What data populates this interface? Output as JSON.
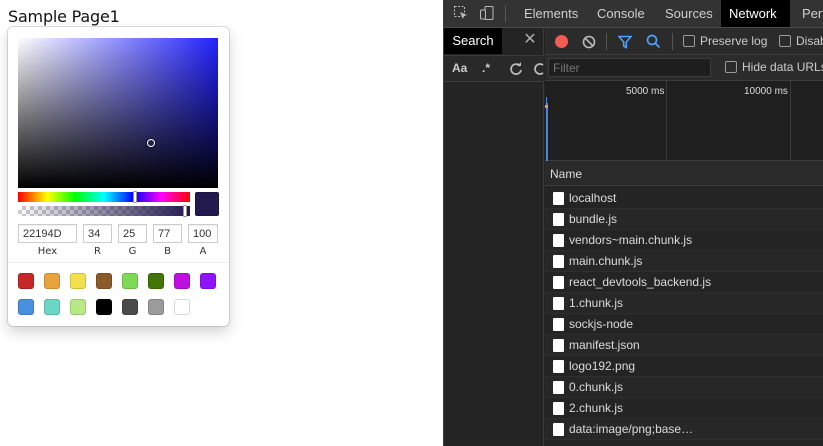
{
  "page": {
    "title": "Sample Page1"
  },
  "color_picker": {
    "current_color": "#22194d",
    "fields": [
      {
        "label": "Hex",
        "value": "22194D"
      },
      {
        "label": "R",
        "value": "34"
      },
      {
        "label": "G",
        "value": "25"
      },
      {
        "label": "B",
        "value": "77"
      },
      {
        "label": "A",
        "value": "100"
      }
    ],
    "presets": [
      "#c62828",
      "#e8a33d",
      "#f4e04d",
      "#8b5a2b",
      "#7ed957",
      "#417505",
      "#bd10e0",
      "#9013fe",
      "#4a90e2",
      "#6dd5c4",
      "#b8e986",
      "#000000",
      "#4a4a4a",
      "#9b9b9b",
      "#ffffff"
    ]
  },
  "devtools": {
    "tabs": [
      {
        "label": "Elements",
        "active": false
      },
      {
        "label": "Console",
        "active": false
      },
      {
        "label": "Sources",
        "active": false
      },
      {
        "label": "Network",
        "active": true
      },
      {
        "label": "Perf",
        "active": false
      }
    ],
    "search": {
      "tab_label": "Search",
      "close": "✕",
      "case_option": "Aa",
      "regex_option": ".*"
    },
    "network": {
      "preserve_log_label": "Preserve log",
      "disable_cache_label": "Disab",
      "filter_placeholder": "Filter",
      "hide_data_urls_label": "Hide data URLs",
      "timeline_ticks": [
        "5000 ms",
        "10000 ms"
      ],
      "name_header": "Name",
      "requests": [
        "localhost",
        "bundle.js",
        "vendors~main.chunk.js",
        "main.chunk.js",
        "react_devtools_backend.js",
        "1.chunk.js",
        "sockjs-node",
        "manifest.json",
        "logo192.png",
        "0.chunk.js",
        "2.chunk.js",
        "data:image/png;base…"
      ]
    }
  }
}
